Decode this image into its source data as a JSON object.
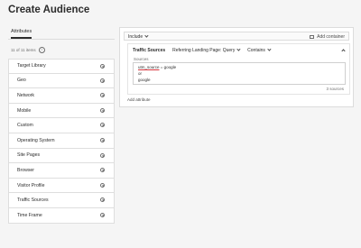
{
  "page": {
    "title": "Create Audience"
  },
  "left": {
    "tab_label": "Attributes",
    "count_text": "11 of 11 items",
    "items": [
      {
        "label": "Target Library"
      },
      {
        "label": "Geo"
      },
      {
        "label": "Network"
      },
      {
        "label": "Mobile"
      },
      {
        "label": "Custom"
      },
      {
        "label": "Operating System"
      },
      {
        "label": "Site Pages"
      },
      {
        "label": "Browser"
      },
      {
        "label": "Visitor Profile"
      },
      {
        "label": "Traffic Sources"
      },
      {
        "label": "Time Frame"
      }
    ]
  },
  "builder": {
    "include_label": "Include",
    "add_container_label": "Add container",
    "rule": {
      "attribute": "Traffic Sources",
      "parameter": "Referring Landing Page: Query",
      "operator": "Contains",
      "sources_label": "Sources",
      "values": {
        "line1_key": "utm_source",
        "line1_rest": " = google",
        "line2": "or",
        "line3": "google"
      },
      "sources_count": "3 sources"
    },
    "add_attribute_label": "Add attribute"
  },
  "colors": {
    "accent_underline": "#d7373f",
    "panel_bg": "#f5f5f5"
  },
  "icons": [
    "info-icon",
    "chevron-right-icon",
    "caret-down-icon",
    "container-icon",
    "collapse-icon"
  ]
}
